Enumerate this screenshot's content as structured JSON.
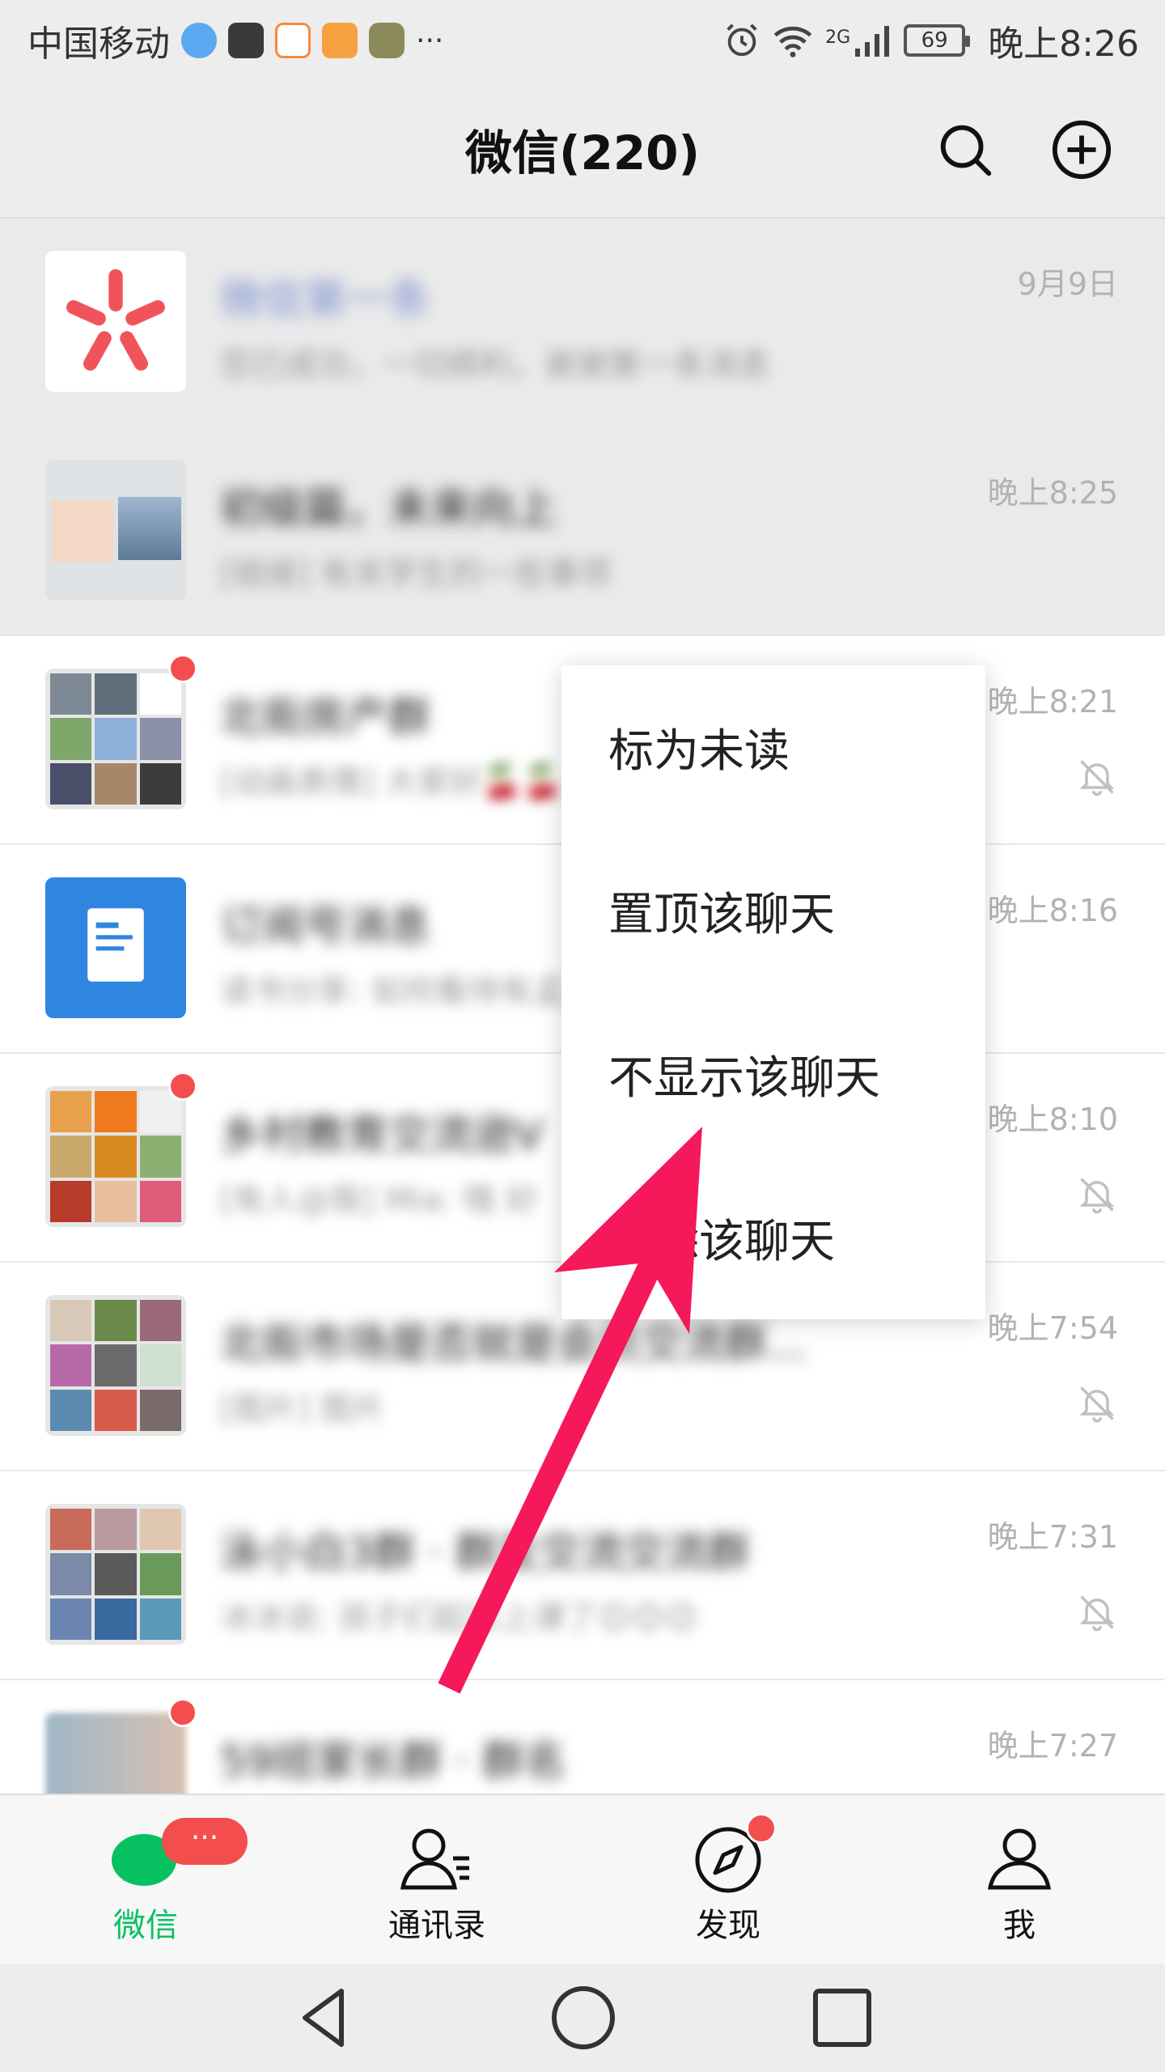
{
  "status_bar": {
    "carrier": "中国移动",
    "dots": "···",
    "network": "2G",
    "battery": "69",
    "time": "晚上8:26"
  },
  "header": {
    "title": "微信(220)",
    "search_icon": "search-icon",
    "add_icon": "plus-circle-icon"
  },
  "chats": [
    {
      "name": "微信第一条",
      "preview": "您已成功，一切顺利，谢谢第一条消息",
      "time": "9月9日",
      "muted": false,
      "unread": false,
      "pinned": true
    },
    {
      "name": "初级篇，未来向上",
      "preview": "[链接] 有关学生的一些事项",
      "time": "晚上8:25",
      "muted": false,
      "unread": false,
      "pinned": true
    },
    {
      "name": "北街房产群",
      "preview": "[动画表情] 大家好🍒🍒",
      "time": "晚上8:21",
      "muted": true,
      "unread": true,
      "pinned": false
    },
    {
      "name": "订阅号消息",
      "preview": "读书分享: 如何看待有孟女",
      "time": "晚上8:16",
      "muted": false,
      "unread": false,
      "pinned": false
    },
    {
      "name": "乡村教育交流逊V",
      "preview": "[有人@我] Mia: 哦 好",
      "time": "晚上8:10",
      "muted": true,
      "unread": true,
      "pinned": false
    },
    {
      "name": "北街市场是否就是会员交流群...",
      "preview": "[图片] 图片",
      "time": "晚上7:54",
      "muted": true,
      "unread": false,
      "pinned": false
    },
    {
      "name": "泳小白3群 · 群友交流交流群",
      "preview": "冰冰说: 孩子们起来上课了😊😊😊",
      "time": "晚上7:31",
      "muted": true,
      "unread": false,
      "pinned": false
    },
    {
      "name": "59班家长群 · 群名",
      "preview": "",
      "time": "晚上7:27",
      "muted": false,
      "unread": true,
      "pinned": false
    }
  ],
  "context_menu": {
    "items": [
      "标为未读",
      "置顶该聊天",
      "不显示该聊天",
      "删除该聊天"
    ]
  },
  "tabs": [
    {
      "label": "微信",
      "icon": "chat-bubble-icon",
      "active": true,
      "badge": "···"
    },
    {
      "label": "通讯录",
      "icon": "contacts-icon",
      "active": false
    },
    {
      "label": "发现",
      "icon": "compass-icon",
      "active": false,
      "badge_dot": true
    },
    {
      "label": "我",
      "icon": "person-icon",
      "active": false
    }
  ],
  "colors": {
    "accent": "#07c160",
    "badge": "#f44d4d",
    "arrow": "#f5185a"
  }
}
